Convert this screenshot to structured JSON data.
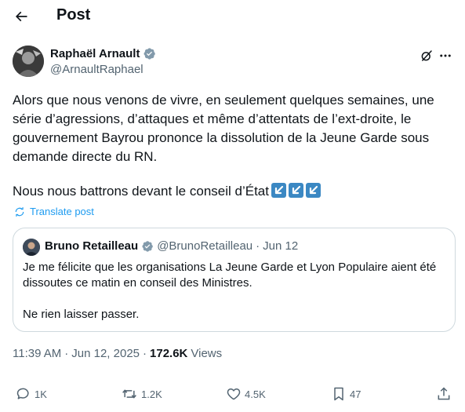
{
  "header": {
    "title": "Post"
  },
  "author": {
    "name": "Raphaël Arnault",
    "handle": "@ArnaultRaphael",
    "verified": true
  },
  "tweet": {
    "paragraph_1": "Alors que nous venons de vivre, en seulement quelques semaines, une série d’agressions, d’attaques et même d’attentats de l’ext-droite, le gouvernement Bayrou prononce la dissolution de la Jeune Garde sous demande directe du RN.",
    "paragraph_2": "Nous nous battrons devant le conseil d’État",
    "emojis": [
      "down-left-arrow-emoji",
      "down-left-arrow-emoji",
      "down-left-arrow-emoji"
    ],
    "translate_label": "Translate post"
  },
  "quote": {
    "name": "Bruno Retailleau",
    "handle": "@BrunoRetailleau",
    "separator": "·",
    "date": "Jun 12",
    "text_1": "Je me félicite que les organisations La Jeune Garde et Lyon Populaire aient été dissoutes ce matin en conseil des Ministres.",
    "text_2": "Ne rien laisser passer."
  },
  "meta": {
    "time": "11:39 AM",
    "separator_1": "·",
    "date": "Jun 12, 2025",
    "separator_2": "·",
    "views_count": "172.6K",
    "views_label": "Views"
  },
  "actions": {
    "replies": "1K",
    "reposts": "1.2K",
    "likes": "4.5K",
    "bookmarks": "47"
  },
  "colors": {
    "text": "#0f1419",
    "muted": "#536471",
    "accent": "#1d9bf0",
    "border": "#cfd9de",
    "emoji_blue": "#3b88c3"
  }
}
